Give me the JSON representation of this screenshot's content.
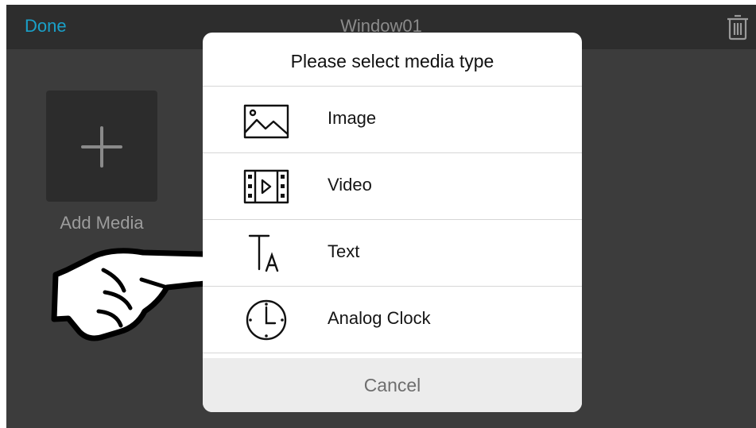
{
  "topbar": {
    "done_label": "Done",
    "window_title": "Window01",
    "trash_icon": "trash-icon"
  },
  "content": {
    "add_media_label": "Add Media",
    "plus_icon": "plus-icon",
    "pointer_icon": "pointing-hand-icon"
  },
  "dialog": {
    "title": "Please select media type",
    "options": [
      {
        "label": "Image",
        "icon": "image-icon"
      },
      {
        "label": "Video",
        "icon": "video-icon"
      },
      {
        "label": "Text",
        "icon": "text-icon"
      },
      {
        "label": "Analog Clock",
        "icon": "analog-clock-icon"
      }
    ],
    "cancel_label": "Cancel"
  },
  "colors": {
    "accent": "#1aa0c8",
    "background": "#3c3c3c",
    "topbar": "#2d2d2d",
    "dialog": "#ffffff",
    "cancel_bg": "#ececec"
  }
}
